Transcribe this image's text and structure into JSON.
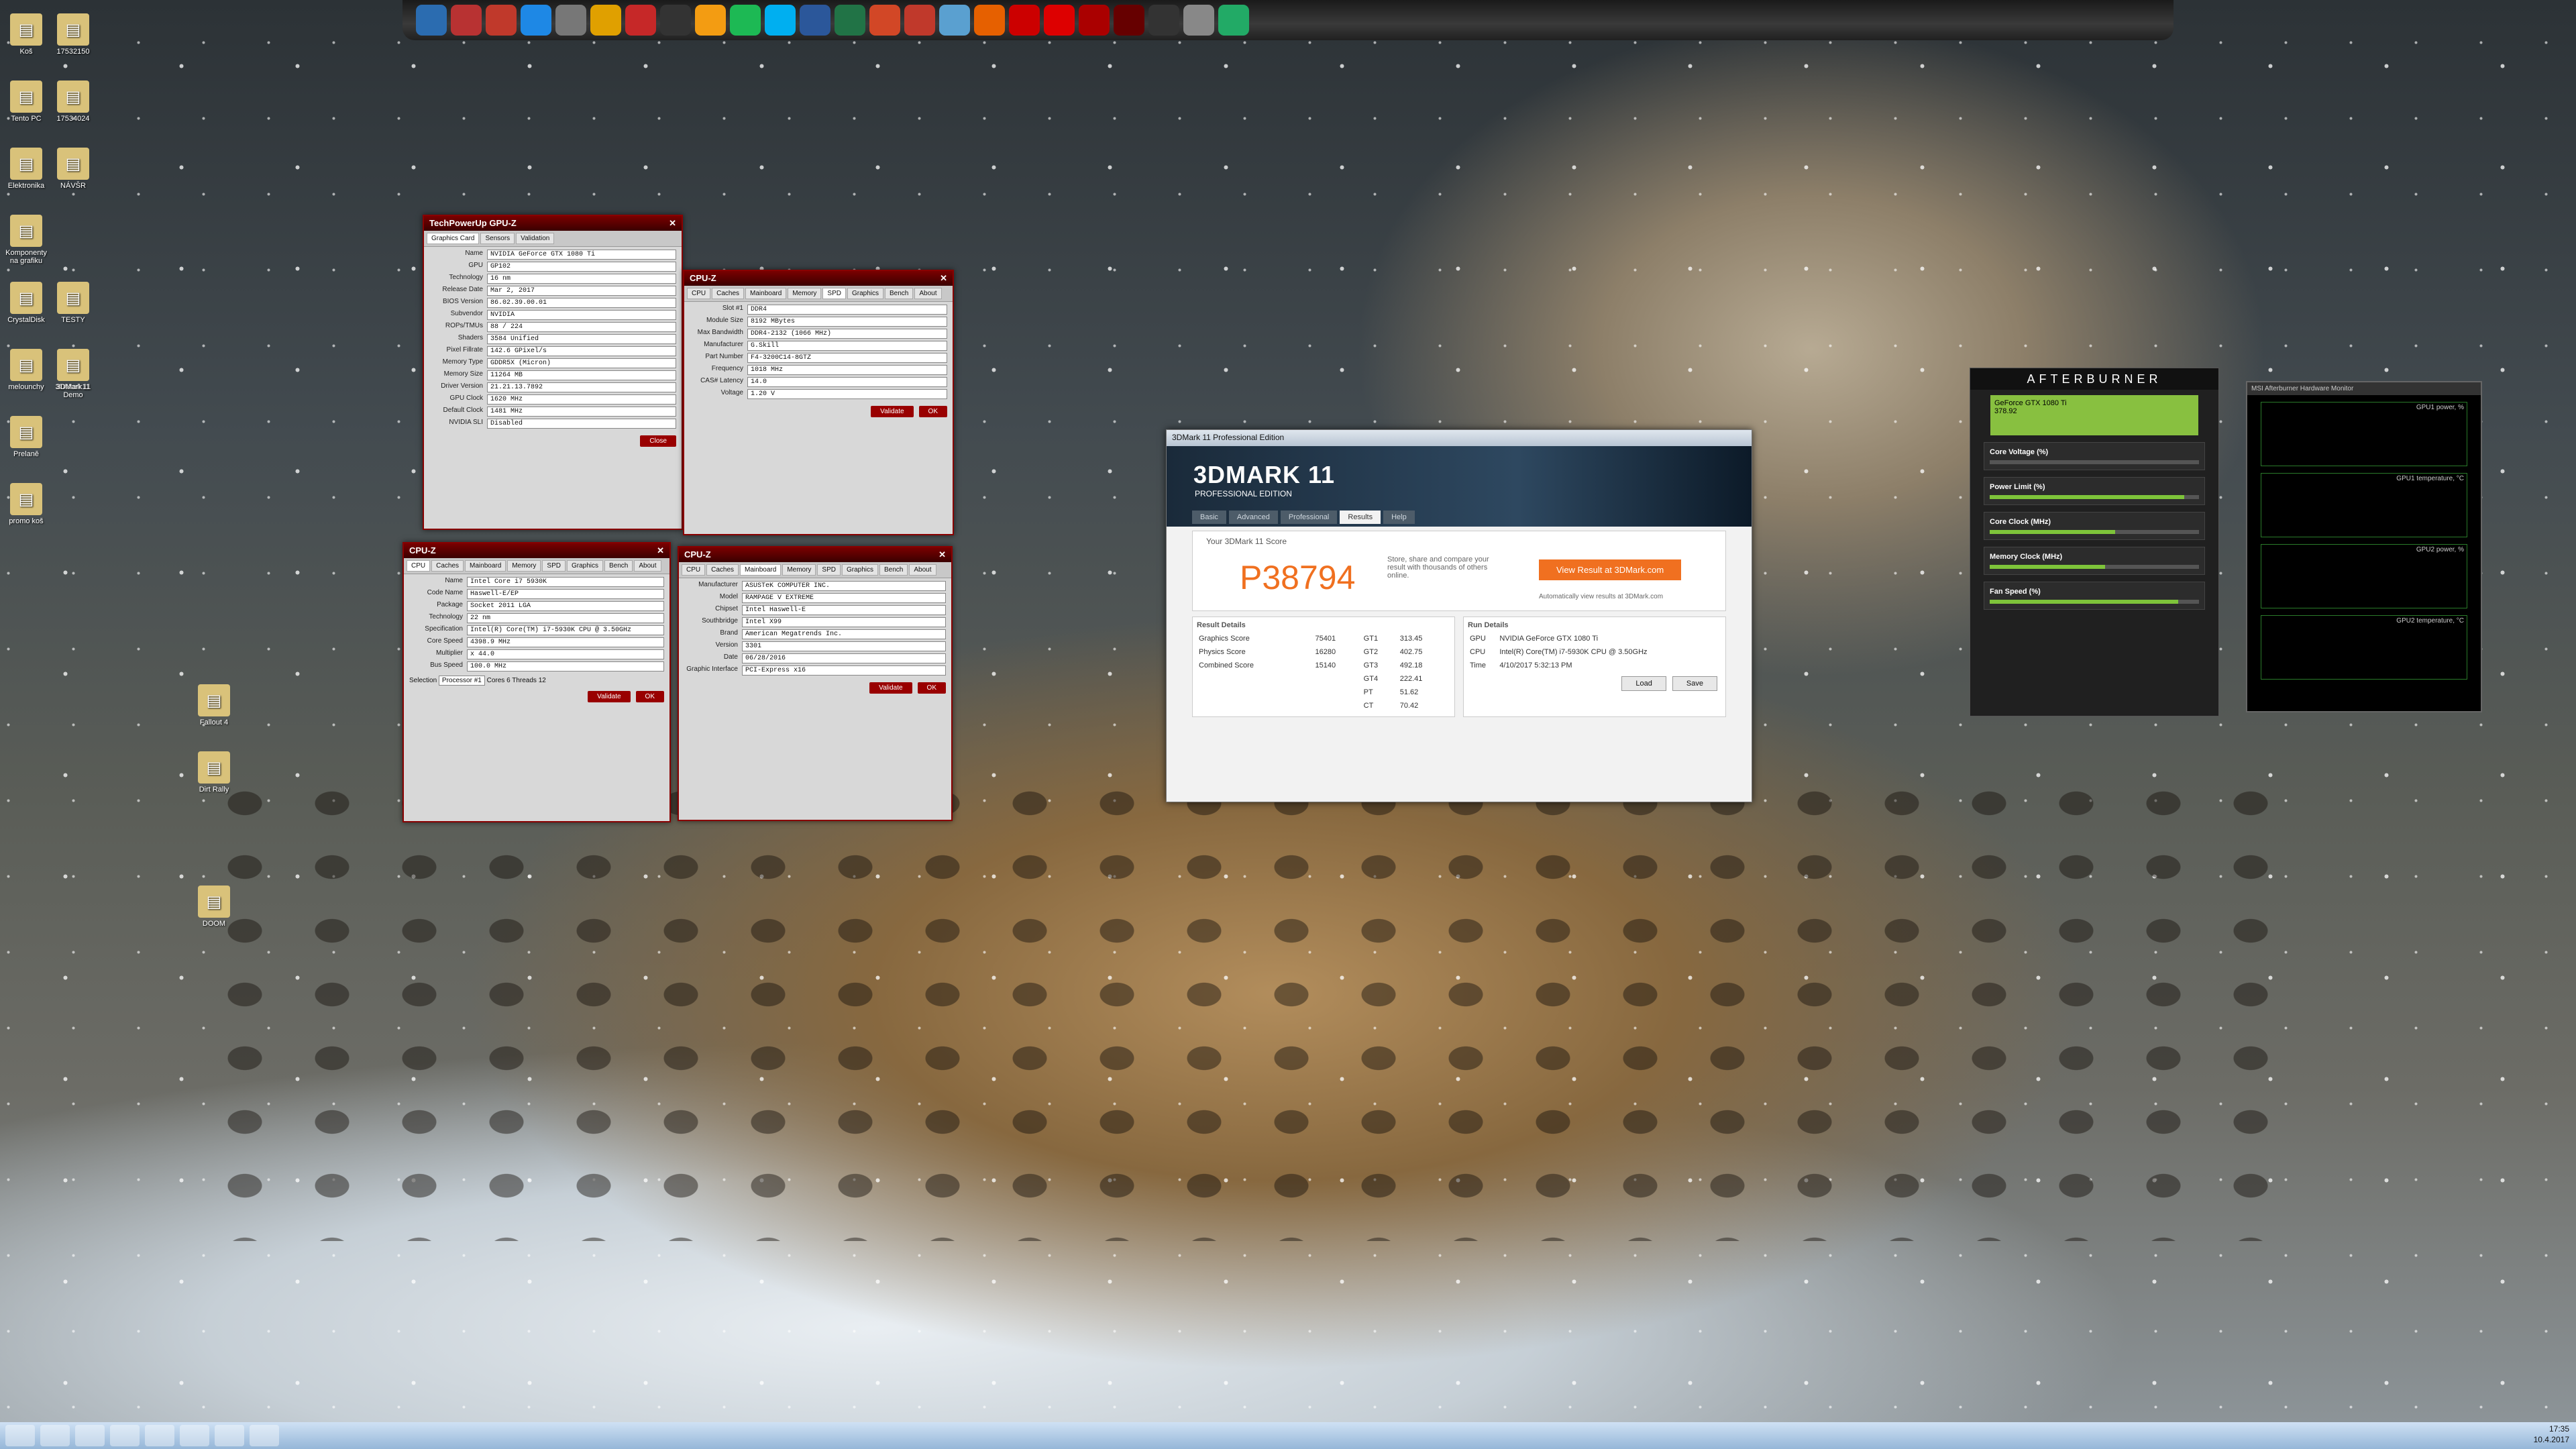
{
  "dock": {
    "icons": [
      "explorer-icon",
      "pen-icon",
      "record-icon",
      "teamviewer-icon",
      "settings-icon",
      "chrome-icon",
      "acrobat-icon",
      "steam-icon",
      "winamp-icon",
      "spotify-icon",
      "skype-icon",
      "word-icon",
      "excel-icon",
      "powerpoint-icon",
      "pdf-icon",
      "paint-icon",
      "firefox-icon",
      "msi-icon",
      "flash-icon",
      "rog-icon",
      "gpuz-icon",
      "steam2-icon",
      "settings2-icon",
      "clock-icon"
    ]
  },
  "desktop": {
    "icons": [
      {
        "label": "Koš"
      },
      {
        "label": "Tento PC"
      },
      {
        "label": "Elektronika"
      },
      {
        "label": "Komponenty na grafiku"
      },
      {
        "label": "CrystalDisk"
      },
      {
        "label": "melounchy"
      },
      {
        "label": "Prelaně"
      },
      {
        "label": "promo koš"
      },
      {
        "label": "Fallout 4"
      },
      {
        "label": "Dirt Rally"
      },
      {
        "label": "DOOM"
      },
      {
        "label": "3DMark 11"
      },
      {
        "label": "17532150"
      },
      {
        "label": "17534024"
      },
      {
        "label": "NÁVŠR"
      },
      {
        "label": "TESTY"
      },
      {
        "label": "3DMark11 Demo"
      }
    ]
  },
  "gpuz": {
    "title": "TechPowerUp GPU-Z",
    "tabs": [
      "Graphics Card",
      "Sensors",
      "Validation"
    ],
    "fields": [
      {
        "k": "Name",
        "v": "NVIDIA GeForce GTX 1080 Ti"
      },
      {
        "k": "GPU",
        "v": "GP102"
      },
      {
        "k": "Technology",
        "v": "16 nm"
      },
      {
        "k": "Release Date",
        "v": "Mar 2, 2017"
      },
      {
        "k": "BIOS Version",
        "v": "86.02.39.00.01"
      },
      {
        "k": "Subvendor",
        "v": "NVIDIA"
      },
      {
        "k": "ROPs/TMUs",
        "v": "88 / 224"
      },
      {
        "k": "Shaders",
        "v": "3584 Unified"
      },
      {
        "k": "Pixel Fillrate",
        "v": "142.6 GPixel/s"
      },
      {
        "k": "Memory Type",
        "v": "GDDR5X (Micron)"
      },
      {
        "k": "Memory Size",
        "v": "11264 MB"
      },
      {
        "k": "Driver Version",
        "v": "21.21.13.7892"
      },
      {
        "k": "GPU Clock",
        "v": "1620 MHz"
      },
      {
        "k": "Default Clock",
        "v": "1481 MHz"
      },
      {
        "k": "NVIDIA SLI",
        "v": "Disabled"
      }
    ],
    "selected": "NVIDIA GeForce GTX 1080 Ti",
    "close": "Close"
  },
  "cpuz_top": {
    "title": "CPU-Z",
    "tabs": [
      "CPU",
      "Caches",
      "Mainboard",
      "Memory",
      "SPD",
      "Graphics",
      "Bench",
      "About"
    ],
    "fields": [
      {
        "k": "Slot #1",
        "v": "DDR4"
      },
      {
        "k": "Module Size",
        "v": "8192 MBytes"
      },
      {
        "k": "Max Bandwidth",
        "v": "DDR4-2132 (1066 MHz)"
      },
      {
        "k": "Manufacturer",
        "v": "G.Skill"
      },
      {
        "k": "Part Number",
        "v": "F4-3200C14-8GTZ"
      },
      {
        "k": "Frequency",
        "v": "1018 MHz"
      },
      {
        "k": "CAS# Latency",
        "v": "14.0"
      },
      {
        "k": "Voltage",
        "v": "1.20 V"
      }
    ],
    "validate": "Validate",
    "ok": "OK"
  },
  "cpuz_left": {
    "title": "CPU-Z",
    "tabs": [
      "CPU",
      "Caches",
      "Mainboard",
      "Memory",
      "SPD",
      "Graphics",
      "Bench",
      "About"
    ],
    "fields": [
      {
        "k": "Name",
        "v": "Intel Core i7 5930K"
      },
      {
        "k": "Code Name",
        "v": "Haswell-E/EP"
      },
      {
        "k": "Package",
        "v": "Socket 2011 LGA"
      },
      {
        "k": "Technology",
        "v": "22 nm"
      },
      {
        "k": "Specification",
        "v": "Intel(R) Core(TM) i7-5930K CPU @ 3.50GHz"
      },
      {
        "k": "Core Speed",
        "v": "4398.9 MHz"
      },
      {
        "k": "Multiplier",
        "v": "x 44.0"
      },
      {
        "k": "Bus Speed",
        "v": "100.0 MHz"
      }
    ],
    "selection": "Processor #1",
    "cores": "6",
    "threads": "12",
    "validate": "Validate",
    "ok": "OK"
  },
  "cpuz_right": {
    "title": "CPU-Z",
    "tabs": [
      "CPU",
      "Caches",
      "Mainboard",
      "Memory",
      "SPD",
      "Graphics",
      "Bench",
      "About"
    ],
    "fields": [
      {
        "k": "Manufacturer",
        "v": "ASUSTeK COMPUTER INC."
      },
      {
        "k": "Model",
        "v": "RAMPAGE V EXTREME"
      },
      {
        "k": "Chipset",
        "v": "Intel Haswell-E"
      },
      {
        "k": "Southbridge",
        "v": "Intel X99"
      },
      {
        "k": "Brand",
        "v": "American Megatrends Inc."
      },
      {
        "k": "Version",
        "v": "3301"
      },
      {
        "k": "Date",
        "v": "06/28/2016"
      },
      {
        "k": "Graphic Interface",
        "v": "PCI-Express x16"
      }
    ],
    "validate": "Validate",
    "ok": "OK"
  },
  "mark": {
    "title": "3DMark 11 Professional Edition",
    "logo": "3DMARK 11",
    "edition": "PROFESSIONAL EDITION",
    "tabs": [
      "Basic",
      "Advanced",
      "Professional",
      "Results",
      "Help"
    ],
    "score_label": "Your 3DMark 11 Score",
    "score": "P38794",
    "desc": "Store, share and compare your result with thousands of others online.",
    "view": "View Result at 3DMark.com",
    "auto": "Automatically view results at 3DMark.com",
    "details": "Result Details",
    "run": "Run Details",
    "results": [
      {
        "name": "Graphics Score",
        "val": "75401",
        "t": "GT1",
        "tv": "313.45"
      },
      {
        "name": "Physics Score",
        "val": "16280",
        "t": "GT2",
        "tv": "402.75"
      },
      {
        "name": "Combined Score",
        "val": "15140",
        "t": "GT3",
        "tv": "492.18"
      },
      {
        "name": "",
        "val": "",
        "t": "GT4",
        "tv": "222.41"
      },
      {
        "name": "",
        "val": "",
        "t": "PT",
        "tv": "51.62"
      },
      {
        "name": "",
        "val": "",
        "t": "CT",
        "tv": "70.42"
      }
    ],
    "run_rows": [
      {
        "k": "GPU",
        "v": "NVIDIA GeForce GTX 1080 Ti"
      },
      {
        "k": "CPU",
        "v": "Intel(R) Core(TM) i7-5930K CPU @ 3.50GHz"
      },
      {
        "k": "Time",
        "v": "4/10/2017 5:32:13 PM"
      }
    ],
    "load": "Load",
    "save": "Save"
  },
  "ab": {
    "title": "AFTERBURNER",
    "gpu": "GeForce GTX 1080 Ti",
    "driver": "378.92",
    "rows": [
      {
        "n": "Core Voltage (%)",
        "p": 0
      },
      {
        "n": "Power Limit (%)",
        "p": 0.93
      },
      {
        "n": "Core Clock (MHz)",
        "p": 0.6
      },
      {
        "n": "Memory Clock (MHz)",
        "p": 0.55
      },
      {
        "n": "Fan Speed (%)",
        "p": 0.9
      }
    ]
  },
  "monitor": {
    "title": "MSI Afterburner Hardware Monitor",
    "graphs": [
      "GPU1 power, %",
      "GPU1 temperature, °C",
      "GPU2 power, %",
      "GPU2 temperature, °C"
    ]
  },
  "taskbar": {
    "icons": [
      "start-icon",
      "skype-icon",
      "explorer-icon",
      "teamviewer-icon",
      "record-icon",
      "steam-icon",
      "folder-icon",
      "winamp-icon"
    ],
    "time": "17:35",
    "date": "10.4.2017"
  }
}
